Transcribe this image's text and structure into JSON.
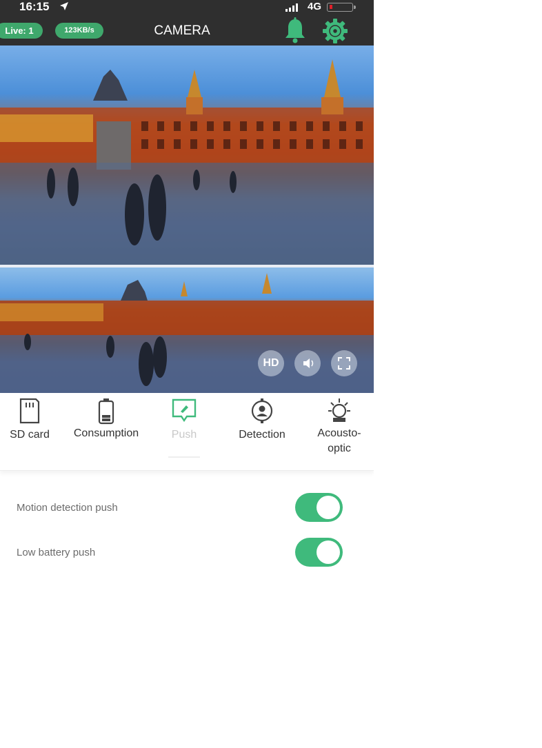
{
  "status_bar": {
    "time": "16:15",
    "network": "4G",
    "battery_level": 0.08,
    "battery_color": "#e0202a"
  },
  "header": {
    "live_badge": "Live: 1",
    "rate_badge": "123KB/s",
    "title": "CAMERA",
    "accent": "#3fba7c",
    "icons": [
      "bell-icon",
      "gear-icon"
    ]
  },
  "video": {
    "controls": {
      "hd_label": "HD",
      "icons": [
        "speaker-icon",
        "fullscreen-icon"
      ]
    }
  },
  "tabs": [
    {
      "label": "SD card",
      "icon": "sd-card-icon"
    },
    {
      "label": "Consumption",
      "icon": "battery-icon"
    },
    {
      "label": "Push",
      "icon": "message-icon",
      "active": true
    },
    {
      "label": "Detection",
      "icon": "detection-icon"
    },
    {
      "label": "Acousto-optic",
      "icon": "light-icon"
    }
  ],
  "settings": [
    {
      "label": "Motion detection push",
      "enabled": true
    },
    {
      "label": "Low battery push",
      "enabled": true
    }
  ]
}
